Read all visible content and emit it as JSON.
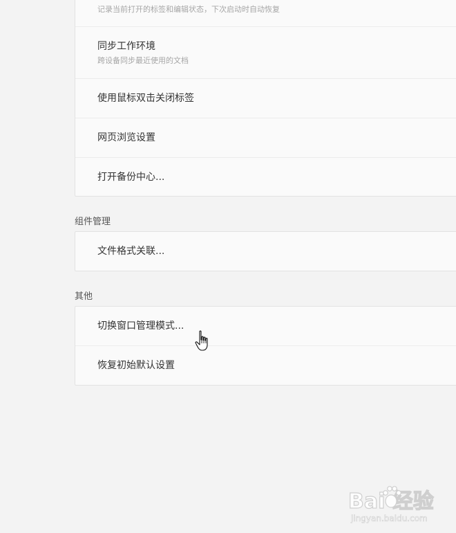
{
  "card1": {
    "items": [
      {
        "desc": "记录当前打开的标签和编辑状态，下次启动时自动恢复"
      },
      {
        "label": "同步工作环境",
        "desc": "跨设备同步最近使用的文档"
      },
      {
        "label": "使用鼠标双击关闭标签"
      },
      {
        "label": "网页浏览设置"
      },
      {
        "label": "打开备份中心..."
      }
    ]
  },
  "sections": {
    "components": {
      "title": "组件管理",
      "items": [
        {
          "label": "文件格式关联..."
        }
      ]
    },
    "other": {
      "title": "其他",
      "items": [
        {
          "label": "切换窗口管理模式..."
        },
        {
          "label": "恢复初始默认设置"
        }
      ]
    }
  },
  "watermark": {
    "logo_text": "Bai 经验",
    "url": "jingyan.baidu.com"
  },
  "icons": {
    "cursor": "hand-pointer-icon"
  }
}
